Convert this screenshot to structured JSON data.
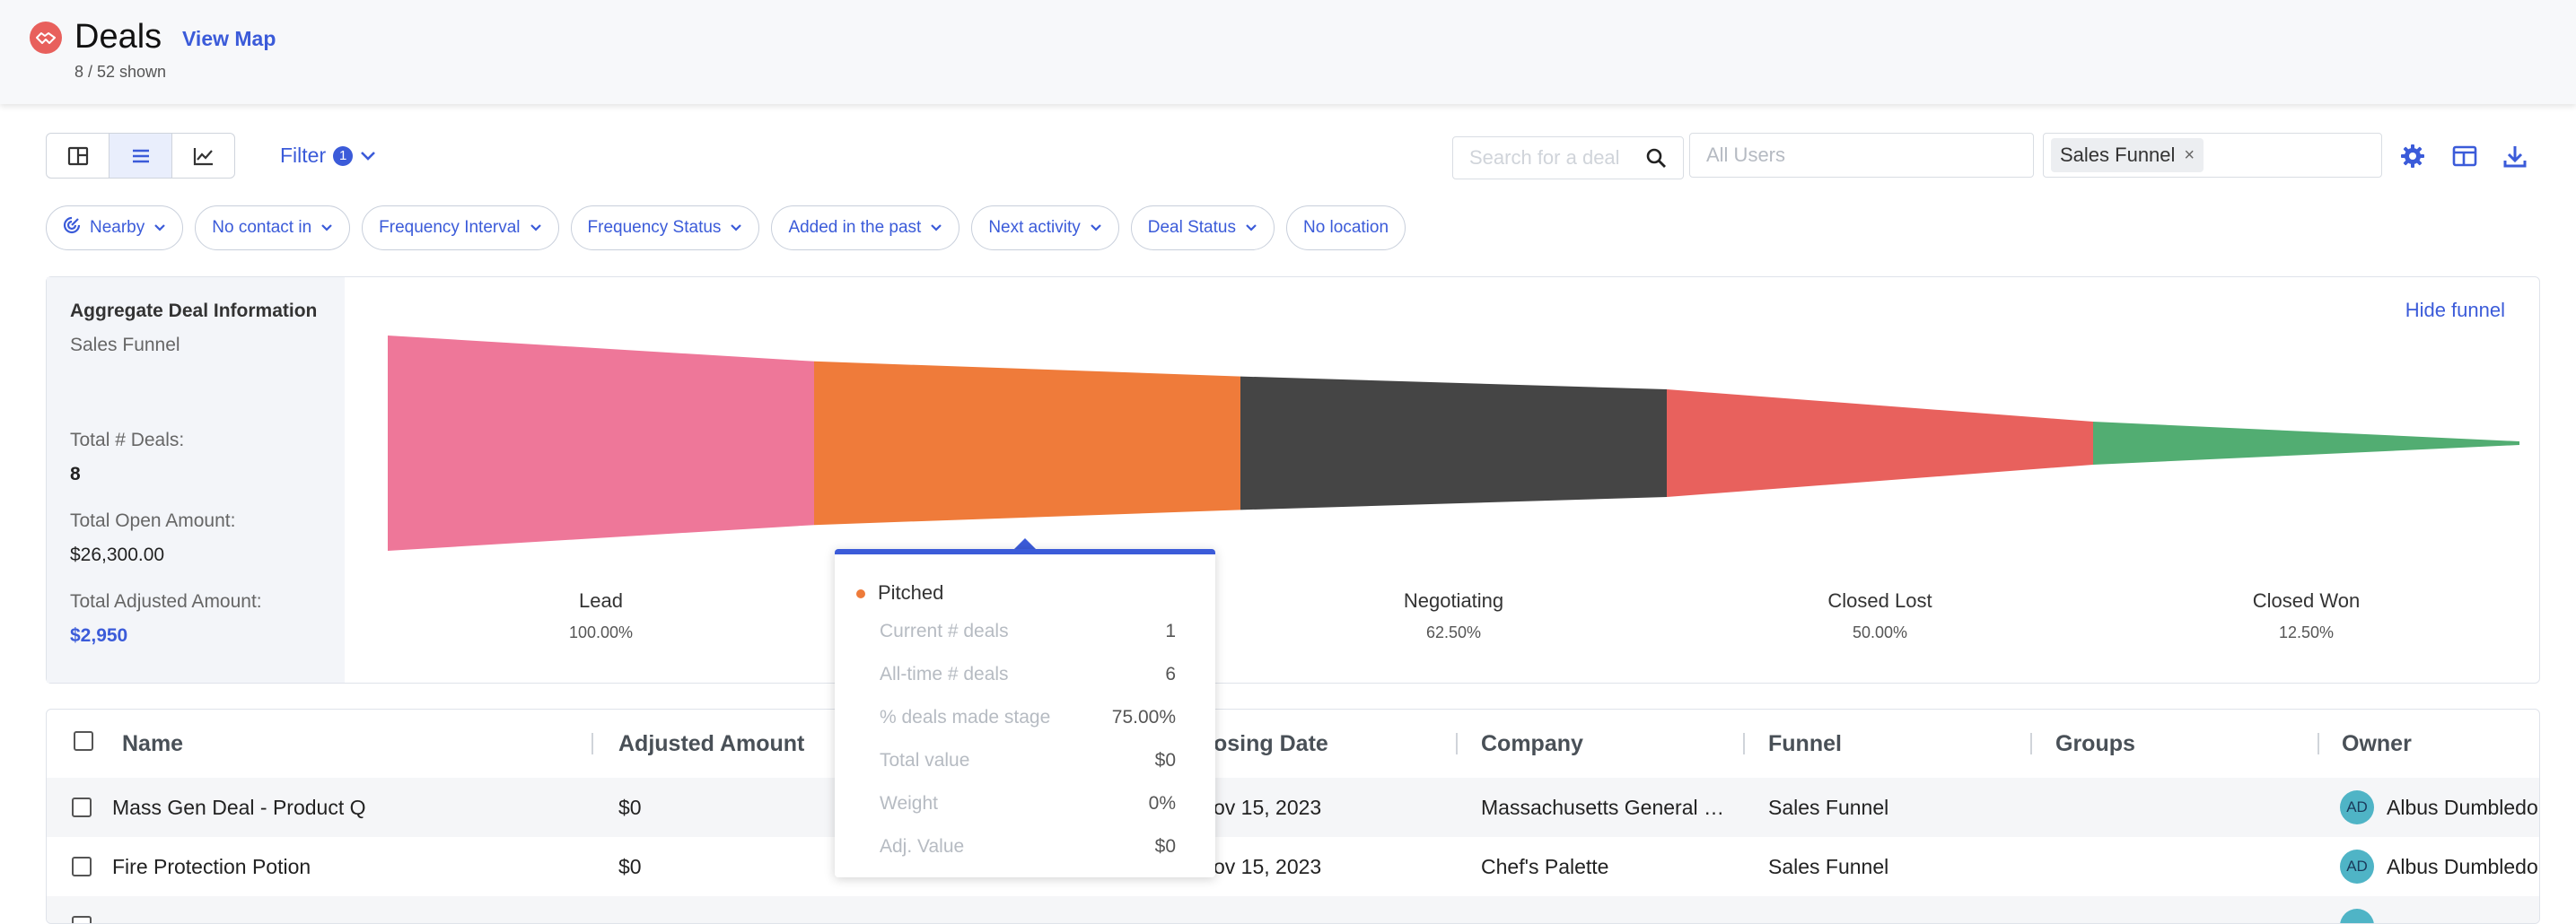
{
  "header": {
    "title": "Deals",
    "view_map": "View Map",
    "shown": "8 / 52 shown",
    "icon": "handshake-icon"
  },
  "toolbar": {
    "views": [
      "board-view-icon",
      "list-view-icon",
      "chart-view-icon"
    ],
    "active_view": "list-view-icon",
    "filter_label": "Filter",
    "filter_count": "1",
    "search_placeholder": "Search for a deal",
    "users_placeholder": "All Users",
    "funnel_tag": "Sales Funnel",
    "right_icons": [
      "settings-icon",
      "columns-icon",
      "download-icon"
    ]
  },
  "chips": [
    {
      "label": "Nearby",
      "icon": "radar-icon"
    },
    {
      "label": "No contact in"
    },
    {
      "label": "Frequency Interval"
    },
    {
      "label": "Frequency Status"
    },
    {
      "label": "Added in the past"
    },
    {
      "label": "Next activity"
    },
    {
      "label": "Deal Status"
    },
    {
      "label": "No location"
    }
  ],
  "aggregate": {
    "title": "Aggregate Deal Information",
    "funnel": "Sales Funnel",
    "total_deals_label": "Total # Deals:",
    "total_deals": "8",
    "open_amount_label": "Total Open Amount:",
    "open_amount": "$26,300.00",
    "adjusted_label": "Total Adjusted Amount:",
    "adjusted_amount": "$2,950",
    "hide_funnel": "Hide funnel"
  },
  "stages": [
    {
      "name": "Lead",
      "pct": "100.00%",
      "color": "#ee7799"
    },
    {
      "name": "Pitched",
      "pct": "75.00%",
      "color": "#ef7b3a"
    },
    {
      "name": "Negotiating",
      "pct": "62.50%",
      "color": "#454545"
    },
    {
      "name": "Closed Lost",
      "pct": "50.00%",
      "color": "#e8615d"
    },
    {
      "name": "Closed Won",
      "pct": "12.50%",
      "color": "#52ad72"
    }
  ],
  "tooltip": {
    "stage": "Pitched",
    "rows": [
      {
        "label": "Current # deals",
        "value": "1"
      },
      {
        "label": "All-time # deals",
        "value": "6"
      },
      {
        "label": "% deals made stage",
        "value": "75.00%"
      },
      {
        "label": "Total value",
        "value": "$0"
      },
      {
        "label": "Weight",
        "value": "0%"
      },
      {
        "label": "Adj. Value",
        "value": "$0"
      }
    ]
  },
  "table": {
    "columns": [
      "Name",
      "Adjusted Amount",
      "osing Date",
      "Company",
      "Funnel",
      "Groups",
      "Owner"
    ],
    "rows": [
      {
        "name": "Mass Gen Deal - Product Q",
        "adjusted": "$0",
        "closing": "ov 15, 2023",
        "company": "Massachusetts General …",
        "funnel": "Sales Funnel",
        "groups": "",
        "owner_initials": "AD",
        "owner": "Albus Dumbledore"
      },
      {
        "name": "Fire Protection Potion",
        "adjusted": "$0",
        "closing": "ov 15, 2023",
        "company": "Chef's Palette",
        "funnel": "Sales Funnel",
        "groups": "",
        "owner_initials": "AD",
        "owner": "Albus Dumbledore"
      }
    ]
  }
}
